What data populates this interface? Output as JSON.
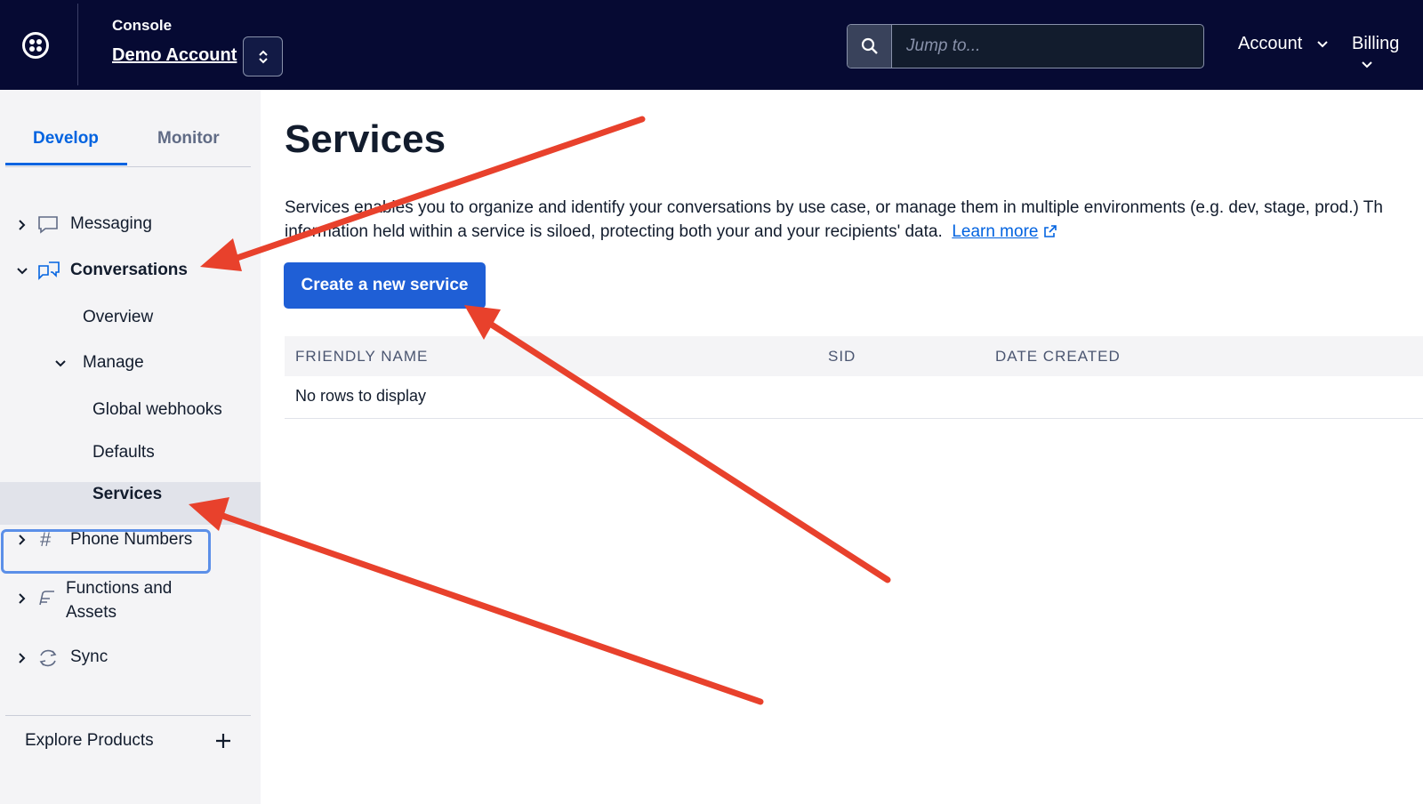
{
  "header": {
    "console_label": "Console",
    "account_name": "Demo Account",
    "search_placeholder": "Jump to...",
    "menus": [
      "Account",
      "Billing"
    ]
  },
  "sidebar": {
    "tabs": {
      "develop": "Develop",
      "monitor": "Monitor"
    },
    "items": {
      "messaging": "Messaging",
      "conversations": "Conversations",
      "overview": "Overview",
      "manage": "Manage",
      "global_webhooks": "Global webhooks",
      "defaults": "Defaults",
      "services": "Services",
      "phone_numbers": "Phone Numbers",
      "functions_line1": "Functions and",
      "functions_line2": "Assets",
      "sync": "Sync"
    },
    "explore_products": "Explore Products"
  },
  "main": {
    "title": "Services",
    "description_line1": "Services enables you to organize and identify your conversations by use case, or manage them in multiple environments (e.g. dev, stage, prod.) Th",
    "description_line2": "information held within a service is siloed, protecting both your and your recipients' data.",
    "learn_more": "Learn more",
    "create_button": "Create a new service",
    "table": {
      "columns": [
        "FRIENDLY NAME",
        "SID",
        "DATE CREATED"
      ],
      "empty_message": "No rows to display"
    }
  },
  "colors": {
    "topbar_bg": "#060a33",
    "accent_blue": "#0263e0",
    "button_blue": "#1f5fd6",
    "annotation_red": "#e8412c"
  },
  "icons": {
    "logo": "twilio-logo-icon",
    "search": "search-icon",
    "messaging": "chat-bubble-icon",
    "conversations": "conversations-icon",
    "phone_numbers": "hash-icon",
    "functions": "functions-icon",
    "sync": "sync-icon",
    "explore": "plus-icon",
    "external": "external-link-icon"
  }
}
